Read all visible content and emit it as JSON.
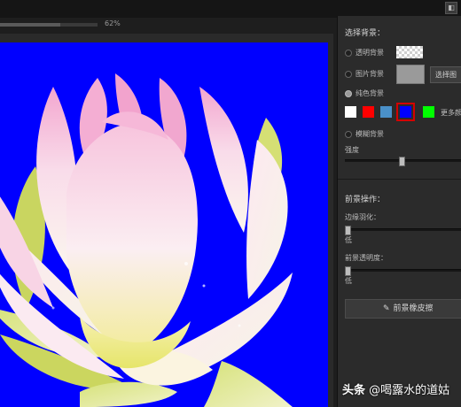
{
  "toolbar": {
    "zoom_label": "62%",
    "zoom_percent": 0.62
  },
  "panel": {
    "background_title": "选择背景：",
    "options": {
      "transparent": "透明背景",
      "image": "图片背景",
      "solid": "纯色背景",
      "blur": "模糊背景"
    },
    "choose_image_button": "选择图",
    "more_colors": "更多颜",
    "blur_strength_label": "强度",
    "blur_strength_value": 0.49,
    "swatch_colors": [
      "#ffffff",
      "#ff0000",
      "#4a90c8",
      "#0000ff",
      "#00ff00"
    ],
    "selected_swatch": 3,
    "foreground_title": "前景操作：",
    "edge_feather_label": "边缘羽化：",
    "edge_feather_scale_label": "低",
    "edge_feather_value": 0.0,
    "fg_opacity_label": "前景透明度：",
    "fg_opacity_scale_label": "低",
    "fg_opacity_value": 0.0,
    "eraser_button": "前景橡皮擦"
  },
  "canvas": {
    "background_color": "#0000ff"
  },
  "watermark": {
    "brand": "头条",
    "handle": "@喝露水的道姑"
  },
  "icons": {
    "eraser": "eraser-icon",
    "window_button": "window-button-icon"
  }
}
